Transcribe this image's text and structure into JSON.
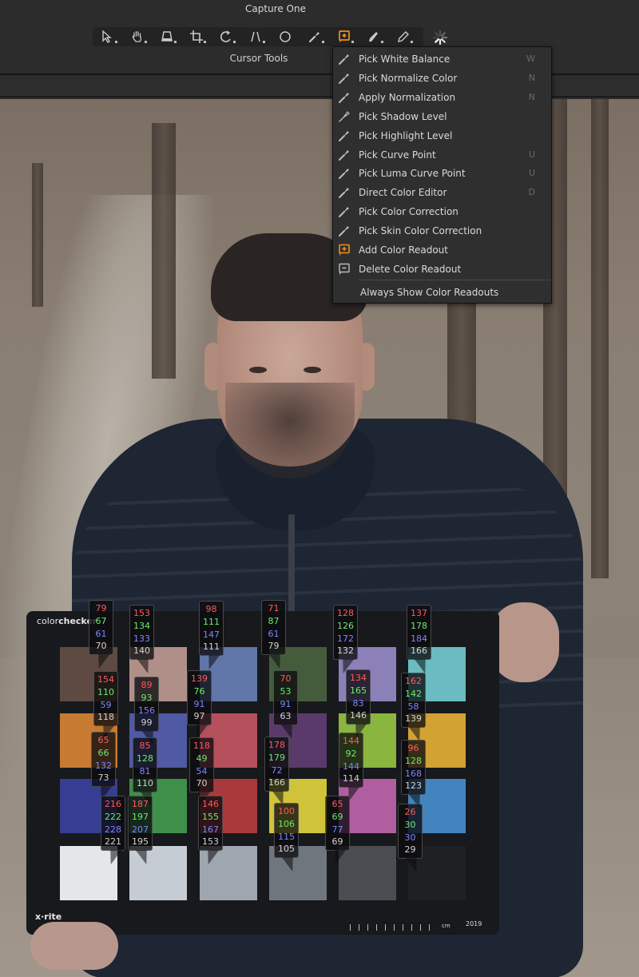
{
  "window": {
    "title": "Capture One"
  },
  "toolbar": {
    "group_label": "Cursor Tools",
    "tools": [
      {
        "name": "select",
        "icon": "pointer-icon",
        "active": false
      },
      {
        "name": "pan",
        "icon": "hand-icon",
        "active": false
      },
      {
        "name": "keystone",
        "icon": "keystone-icon",
        "active": false
      },
      {
        "name": "crop",
        "icon": "crop-icon",
        "active": false
      },
      {
        "name": "rotate",
        "icon": "rotate-icon",
        "active": false
      },
      {
        "name": "lens",
        "icon": "lens-icon",
        "active": false
      },
      {
        "name": "spot-removal",
        "icon": "circle-icon",
        "active": false
      },
      {
        "name": "picker",
        "icon": "eyedropper-icon",
        "active": false
      },
      {
        "name": "color-readout",
        "icon": "color-readout-icon",
        "active": true
      },
      {
        "name": "brush",
        "icon": "brush-icon",
        "active": false
      },
      {
        "name": "annotate",
        "icon": "pencil-icon",
        "active": false
      }
    ],
    "spinner_icon": "loading-icon",
    "accent_color": "#f0901e"
  },
  "menu": {
    "items": [
      {
        "label": "Pick White Balance",
        "shortcut": "W",
        "icon": "eyedropper-icon"
      },
      {
        "label": "Pick Normalize Color",
        "shortcut": "N",
        "icon": "eyedropper-normalize-icon"
      },
      {
        "label": "Apply Normalization",
        "shortcut": "N",
        "icon": "eyedropper-apply-icon"
      },
      {
        "label": "Pick Shadow Level",
        "shortcut": "",
        "icon": "eyedropper-shadow-icon"
      },
      {
        "label": "Pick Highlight Level",
        "shortcut": "",
        "icon": "eyedropper-highlight-icon"
      },
      {
        "label": "Pick Curve Point",
        "shortcut": "U",
        "icon": "eyedropper-curve-icon"
      },
      {
        "label": "Pick Luma Curve Point",
        "shortcut": "U",
        "icon": "eyedropper-luma-icon"
      },
      {
        "label": "Direct Color Editor",
        "shortcut": "D",
        "icon": "eyedropper-color-editor-icon"
      },
      {
        "label": "Pick Color Correction",
        "shortcut": "",
        "icon": "eyedropper-color-correction-icon"
      },
      {
        "label": "Pick Skin Color Correction",
        "shortcut": "",
        "icon": "eyedropper-skin-icon"
      },
      {
        "label": "Add Color Readout",
        "shortcut": "",
        "icon": "add-color-readout-icon"
      },
      {
        "label": "Delete Color Readout",
        "shortcut": "",
        "icon": "delete-color-readout-icon"
      }
    ],
    "toggle_label": "Always Show Color Readouts"
  },
  "checker": {
    "brand_prefix": "color",
    "brand_bold": "checker",
    "maker": "x·rite",
    "ruler_unit": "cm",
    "year": "2019",
    "swatch_colors": [
      [
        "#5e4a42",
        "#b18f89",
        "#6075a8",
        "#455c3c",
        "#8c80b9",
        "#6bbcc0"
      ],
      [
        "#c77a32",
        "#5059a3",
        "#b4505b",
        "#5a3a6b",
        "#8ab53e",
        "#d2a233"
      ],
      [
        "#353e92",
        "#3e8f4a",
        "#a83a3c",
        "#cfc33a",
        "#b05ea0",
        "#4284c0"
      ],
      [
        "#e4e6ea",
        "#c5ccd4",
        "#9ea6af",
        "#70767d",
        "#4a4e53",
        "#1e2023"
      ]
    ]
  },
  "readouts": [
    {
      "r": "79",
      "g": "67",
      "b": "61",
      "l": "70"
    },
    {
      "r": "153",
      "g": "134",
      "b": "133",
      "l": "140"
    },
    {
      "r": "98",
      "g": "111",
      "b": "147",
      "l": "111"
    },
    {
      "r": "71",
      "g": "87",
      "b": "61",
      "l": "79"
    },
    {
      "r": "128",
      "g": "126",
      "b": "172",
      "l": "132"
    },
    {
      "r": "137",
      "g": "178",
      "b": "184",
      "l": "166"
    },
    {
      "r": "154",
      "g": "110",
      "b": "59",
      "l": "118"
    },
    {
      "r": "89",
      "g": "93",
      "b": "156",
      "l": "99"
    },
    {
      "r": "139",
      "g": "76",
      "b": "91",
      "l": "97"
    },
    {
      "r": "70",
      "g": "53",
      "b": "91",
      "l": "63"
    },
    {
      "r": "134",
      "g": "165",
      "b": "83",
      "l": "146"
    },
    {
      "r": "162",
      "g": "142",
      "b": "58",
      "l": "139"
    },
    {
      "r": "65",
      "g": "66",
      "b": "132",
      "l": "73"
    },
    {
      "r": "85",
      "g": "128",
      "b": "81",
      "l": "110"
    },
    {
      "r": "118",
      "g": "49",
      "b": "54",
      "l": "70"
    },
    {
      "r": "178",
      "g": "179",
      "b": "72",
      "l": "166"
    },
    {
      "r": "144",
      "g": "92",
      "b": "144",
      "l": "114"
    },
    {
      "r": "96",
      "g": "128",
      "b": "168",
      "l": "123"
    },
    {
      "r": "216",
      "g": "222",
      "b": "228",
      "l": "221"
    },
    {
      "r": "187",
      "g": "197",
      "b": "207",
      "l": "195"
    },
    {
      "r": "146",
      "g": "155",
      "b": "167",
      "l": "153"
    },
    {
      "r": "100",
      "g": "106",
      "b": "115",
      "l": "105"
    },
    {
      "r": "65",
      "g": "69",
      "b": "77",
      "l": "69"
    },
    {
      "r": "26",
      "g": "30",
      "b": "30",
      "l": "29"
    }
  ]
}
